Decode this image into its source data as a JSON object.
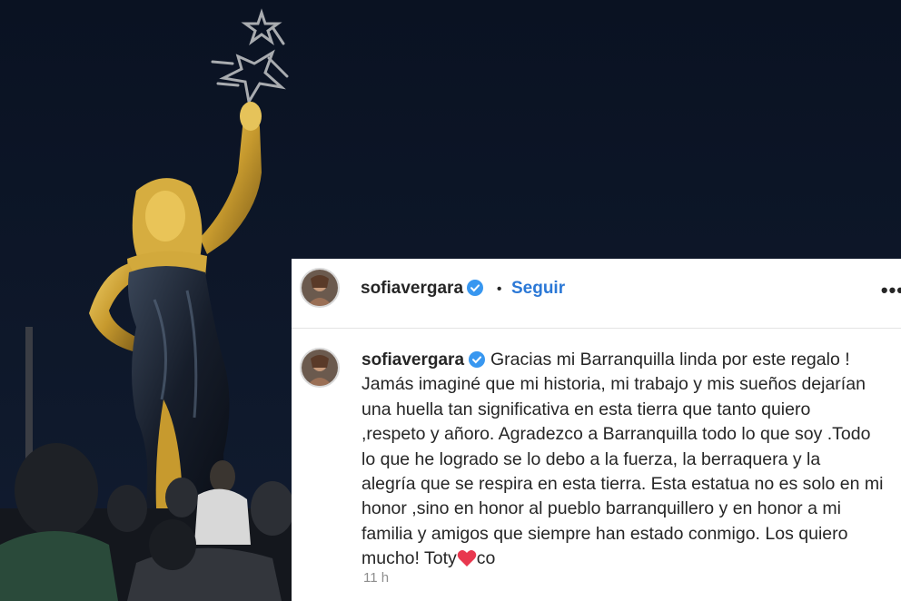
{
  "post": {
    "username": "sofiavergara",
    "verified": true,
    "dot": "•",
    "follow_label": "Seguir",
    "more_label": "•••",
    "caption_lines": [
      "Gracias mi Barranquilla linda por este regalo !",
      "Jamás imaginé que mi historia, mi trabajo y mis sueños dejarían",
      "una huella tan significativa en esta tierra que tanto quiero",
      ",respeto y añoro. Agradezco a Barranquilla todo lo que soy .Todo",
      "lo que he logrado se lo debo a la fuerza, la berraquera y la",
      "alegría que se respira en esta tierra. Esta estatua no es solo en mi",
      "honor ,sino en honor al pueblo barranquillero y en honor a mi",
      "familia y amigos que siempre han estado conmigo. Los quiero",
      "mucho! Toty"
    ],
    "caption_suffix": "co",
    "time_ago": "11 h"
  },
  "colors": {
    "night_sky": "#0c1424",
    "link_blue": "#2b78d6",
    "verified_blue": "#3897f0",
    "heart_red": "#e8384f",
    "statue_gold": "#d2a93c"
  },
  "icons": [
    "verified-badge-icon",
    "more-options-icon",
    "heart-emoji-icon"
  ]
}
